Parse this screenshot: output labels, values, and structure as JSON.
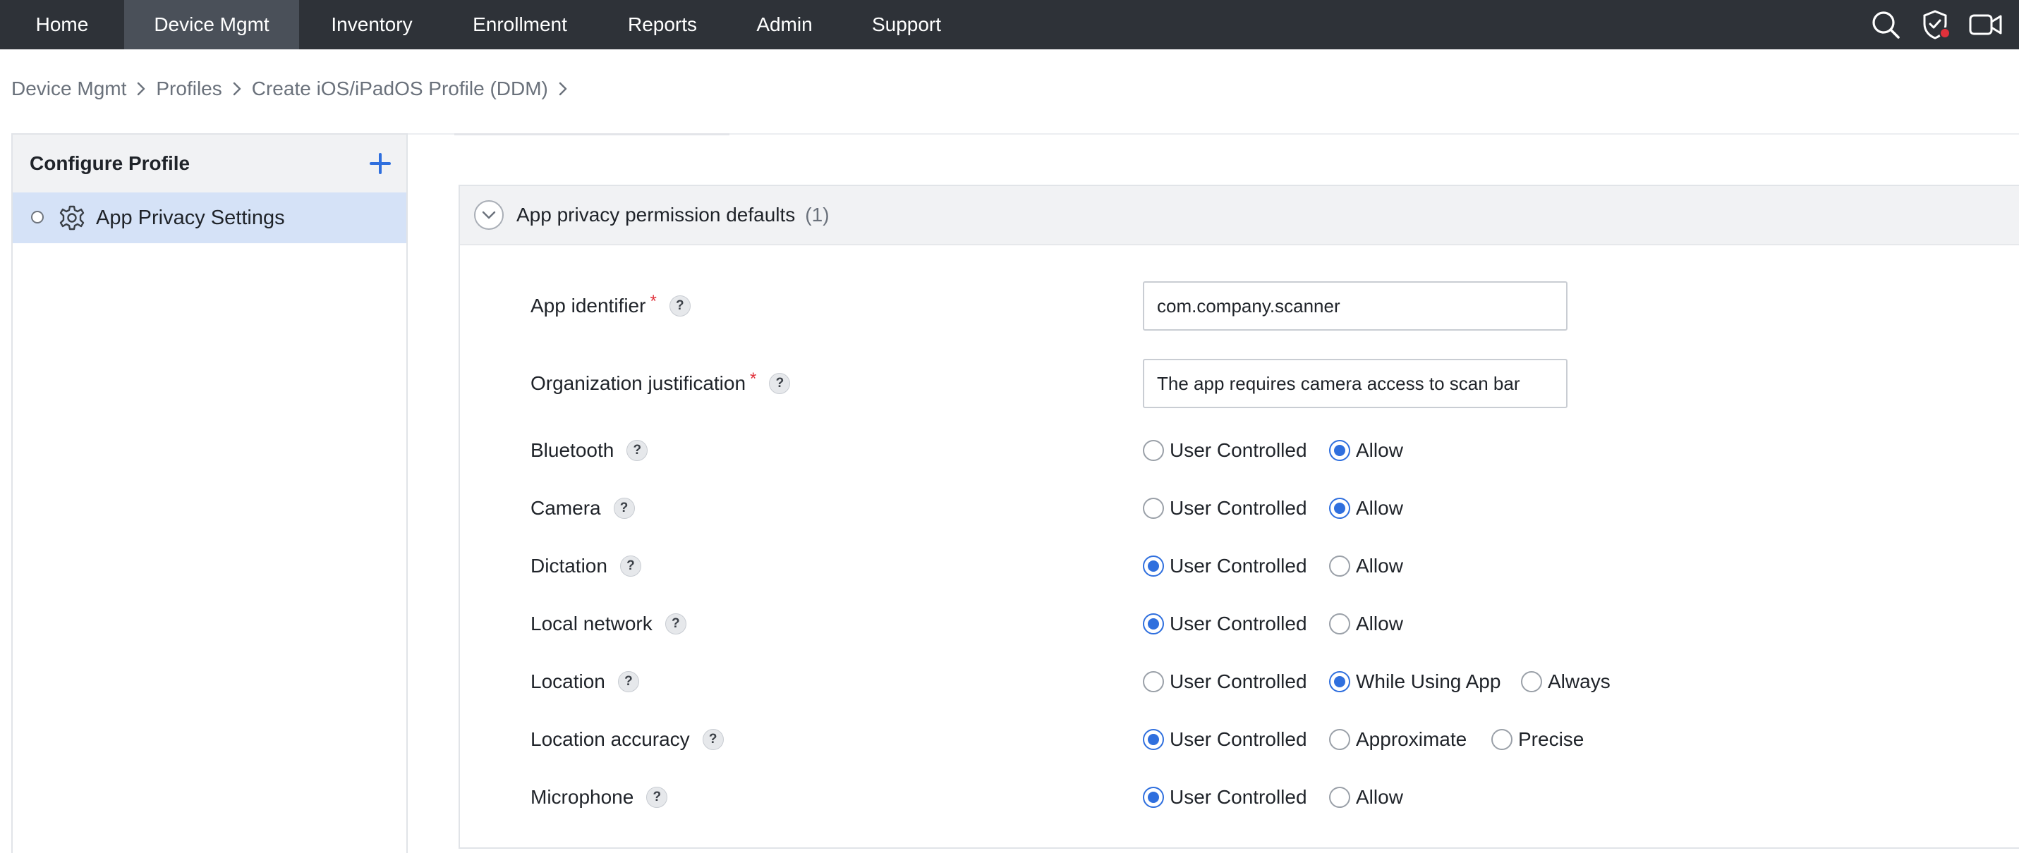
{
  "nav": {
    "items": [
      {
        "label": "Home",
        "active": false
      },
      {
        "label": "Device Mgmt",
        "active": true
      },
      {
        "label": "Inventory",
        "active": false
      },
      {
        "label": "Enrollment",
        "active": false
      },
      {
        "label": "Reports",
        "active": false
      },
      {
        "label": "Admin",
        "active": false
      },
      {
        "label": "Support",
        "active": false
      }
    ],
    "icons": [
      "search-icon",
      "shield-alert-icon",
      "video-camera-icon"
    ],
    "active_bg": "#4a5059",
    "bar_bg": "#2e3238"
  },
  "breadcrumb": {
    "items": [
      "Device Mgmt",
      "Profiles",
      "Create iOS/iPadOS Profile (DDM)"
    ]
  },
  "sidebar": {
    "title": "Configure Profile",
    "add_icon": "plus-icon",
    "items": [
      {
        "label": "App Privacy Settings",
        "icon": "gear-icon",
        "selected": true
      }
    ],
    "selected_bg": "#d5e2f7"
  },
  "panel": {
    "title": "App privacy permission defaults",
    "count": "(1)",
    "fields": {
      "app_identifier": {
        "label": "App identifier",
        "required": true,
        "value": "com.company.scanner"
      },
      "org_justification": {
        "label": "Organization justification",
        "required": true,
        "value": "The app requires camera access to scan bar"
      }
    },
    "permissions": [
      {
        "label": "Bluetooth",
        "options": [
          "User Controlled",
          "Allow"
        ],
        "selected": "Allow"
      },
      {
        "label": "Camera",
        "options": [
          "User Controlled",
          "Allow"
        ],
        "selected": "Allow"
      },
      {
        "label": "Dictation",
        "options": [
          "User Controlled",
          "Allow"
        ],
        "selected": "User Controlled"
      },
      {
        "label": "Local network",
        "options": [
          "User Controlled",
          "Allow"
        ],
        "selected": "User Controlled"
      },
      {
        "label": "Location",
        "options": [
          "User Controlled",
          "While Using App",
          "Always"
        ],
        "selected": "While Using App"
      },
      {
        "label": "Location accuracy",
        "options": [
          "User Controlled",
          "Approximate",
          "Precise"
        ],
        "selected": "User Controlled"
      },
      {
        "label": "Microphone",
        "options": [
          "User Controlled",
          "Allow"
        ],
        "selected": "User Controlled"
      }
    ],
    "help_symbol": "?",
    "accent": "#2f6fde",
    "required_color": "#e0313b"
  }
}
